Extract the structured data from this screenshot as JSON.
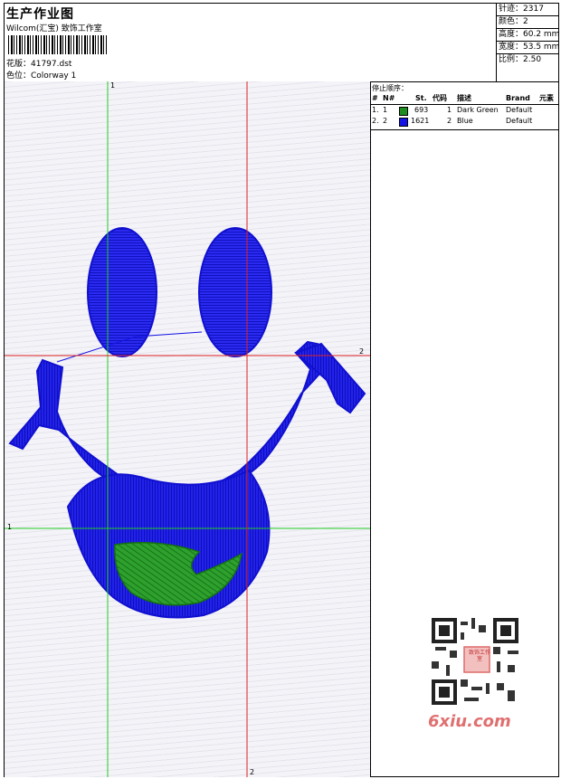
{
  "header": {
    "title": "生产作业图",
    "studio": "Wilcom(汇宝) 致饰工作室",
    "pattern": "花版：41797.dst",
    "colorway": "色位：Colorway 1"
  },
  "stats": [
    {
      "label": "针迹：",
      "value": "2317"
    },
    {
      "label": "颜色：",
      "value": "2"
    },
    {
      "label": "高度：",
      "value": "60.2 mm"
    },
    {
      "label": "宽度：",
      "value": "53.5 mm"
    },
    {
      "label": "比例：",
      "value": "2.50"
    }
  ],
  "stop_sequence": {
    "title": "停止顺序：",
    "columns": [
      "#",
      "N#",
      "St.",
      "代码",
      "描述",
      "Brand",
      "元素"
    ],
    "rows": [
      {
        "index": "1.",
        "needle": "1",
        "stitches": "693",
        "code": "1",
        "description": "Dark Green",
        "brand": "Default",
        "color": "#1e8c1e"
      },
      {
        "index": "2.",
        "needle": "2",
        "stitches": "1621",
        "code": "2",
        "description": "Blue",
        "brand": "Default",
        "color": "#1414e6"
      }
    ]
  },
  "guides": {
    "green_top": "1",
    "green_left": "1",
    "red_right": "2",
    "red_bottom": "2"
  },
  "watermark": {
    "text": "6xiu.com",
    "stamp_text": "致饰工作室"
  },
  "colors": {
    "blue_thread": "#1414e6",
    "green_thread": "#1e8c1e",
    "guide_green": "#22cc22",
    "guide_red": "#dd2222"
  }
}
